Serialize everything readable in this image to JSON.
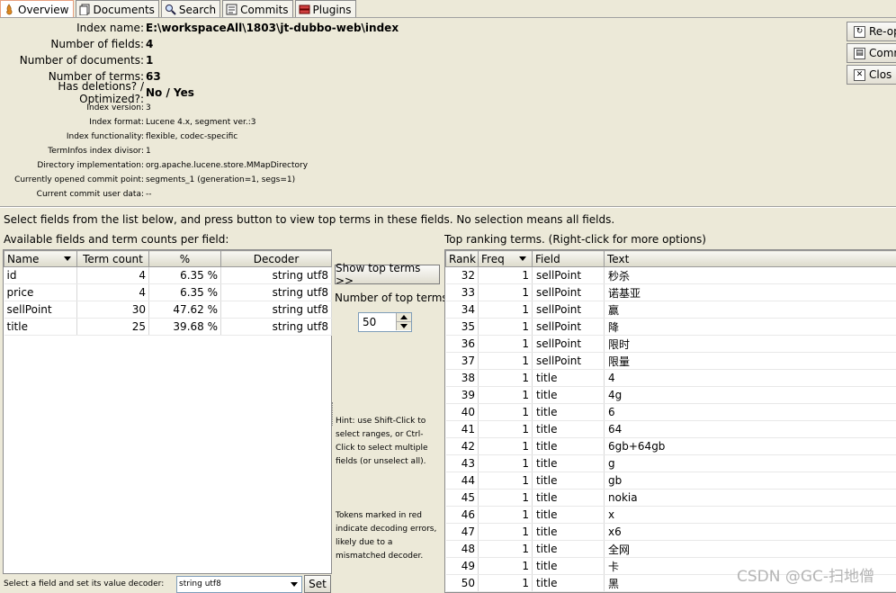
{
  "tabs": [
    {
      "label": "Overview",
      "icon": "flame-icon",
      "active": true
    },
    {
      "label": "Documents",
      "icon": "documents-icon",
      "active": false
    },
    {
      "label": "Search",
      "icon": "search-icon",
      "active": false
    },
    {
      "label": "Commits",
      "icon": "commits-icon",
      "active": false
    },
    {
      "label": "Plugins",
      "icon": "plugins-icon",
      "active": false
    }
  ],
  "index_info": {
    "index_name_label": "Index name:",
    "index_name": "E:\\workspaceAll\\1803\\jt-dubbo-web\\index",
    "num_fields_label": "Number of fields:",
    "num_fields": "4",
    "num_docs_label": "Number of documents:",
    "num_docs": "1",
    "num_terms_label": "Number of terms:",
    "num_terms": "63",
    "deletions_label": "Has deletions? / Optimized?:",
    "deletions": "No / Yes",
    "version_label": "Index version:",
    "version": "3",
    "format_label": "Index format:",
    "format": "Lucene 4.x, segment ver.:3",
    "functionality_label": "Index functionality:",
    "functionality": "flexible, codec-specific",
    "divisor_label": "TermInfos index divisor:",
    "divisor": "1",
    "directory_label": "Directory implementation:",
    "directory": "org.apache.lucene.store.MMapDirectory",
    "commit_point_label": "Currently opened commit point:",
    "commit_point": "segments_1 (generation=1, segs=1)",
    "user_data_label": "Current commit user data:",
    "user_data": "--"
  },
  "side_buttons": [
    {
      "label": "Re-op",
      "icon": "reopen-icon"
    },
    {
      "label": "Comm",
      "icon": "commit-icon"
    },
    {
      "label": "Clos",
      "icon": "close-icon"
    }
  ],
  "instructions": "Select fields from the list below, and press button to view top terms in these fields. No selection means all fields.",
  "fields_panel": {
    "title": "Available fields and term counts per field:",
    "headers": [
      "Name",
      "Term count",
      "%",
      "Decoder"
    ],
    "rows": [
      {
        "name": "id",
        "count": "4",
        "pct": "6.35 %",
        "decoder": "string utf8"
      },
      {
        "name": "price",
        "count": "4",
        "pct": "6.35 %",
        "decoder": "string utf8"
      },
      {
        "name": "sellPoint",
        "count": "30",
        "pct": "47.62 %",
        "decoder": "string utf8"
      },
      {
        "name": "title",
        "count": "25",
        "pct": "39.68 %",
        "decoder": "string utf8"
      }
    ],
    "decoder_label": "Select a field and set its value decoder:",
    "decoder_value": "string utf8",
    "set_button": "Set"
  },
  "middle": {
    "show_top_terms": "Show top terms >>",
    "num_top_terms_label": "Number of top terms:",
    "num_top_terms": "50",
    "hint": "Hint: use Shift-Click to select ranges, or Ctrl-Click to select multiple fields (or unselect all).",
    "tokens_note": "Tokens marked in red indicate decoding errors, likely due to a mismatched decoder."
  },
  "terms_panel": {
    "title": "Top ranking terms. (Right-click for more options)",
    "headers": [
      "Rank",
      "Freq",
      "Field",
      "Text"
    ],
    "rows": [
      {
        "rank": "32",
        "freq": "1",
        "field": "sellPoint",
        "text": "秒杀"
      },
      {
        "rank": "33",
        "freq": "1",
        "field": "sellPoint",
        "text": "诺基亚"
      },
      {
        "rank": "34",
        "freq": "1",
        "field": "sellPoint",
        "text": "赢"
      },
      {
        "rank": "35",
        "freq": "1",
        "field": "sellPoint",
        "text": "降"
      },
      {
        "rank": "36",
        "freq": "1",
        "field": "sellPoint",
        "text": "限时"
      },
      {
        "rank": "37",
        "freq": "1",
        "field": "sellPoint",
        "text": "限量"
      },
      {
        "rank": "38",
        "freq": "1",
        "field": "title",
        "text": "4"
      },
      {
        "rank": "39",
        "freq": "1",
        "field": "title",
        "text": "4g"
      },
      {
        "rank": "40",
        "freq": "1",
        "field": "title",
        "text": "6"
      },
      {
        "rank": "41",
        "freq": "1",
        "field": "title",
        "text": "64"
      },
      {
        "rank": "42",
        "freq": "1",
        "field": "title",
        "text": "6gb+64gb"
      },
      {
        "rank": "43",
        "freq": "1",
        "field": "title",
        "text": "g"
      },
      {
        "rank": "44",
        "freq": "1",
        "field": "title",
        "text": "gb"
      },
      {
        "rank": "45",
        "freq": "1",
        "field": "title",
        "text": "nokia"
      },
      {
        "rank": "46",
        "freq": "1",
        "field": "title",
        "text": "x"
      },
      {
        "rank": "47",
        "freq": "1",
        "field": "title",
        "text": "x6"
      },
      {
        "rank": "48",
        "freq": "1",
        "field": "title",
        "text": "全网"
      },
      {
        "rank": "49",
        "freq": "1",
        "field": "title",
        "text": "卡"
      },
      {
        "rank": "50",
        "freq": "1",
        "field": "title",
        "text": "黑"
      }
    ]
  },
  "watermark": "CSDN @GC-扫地僧"
}
